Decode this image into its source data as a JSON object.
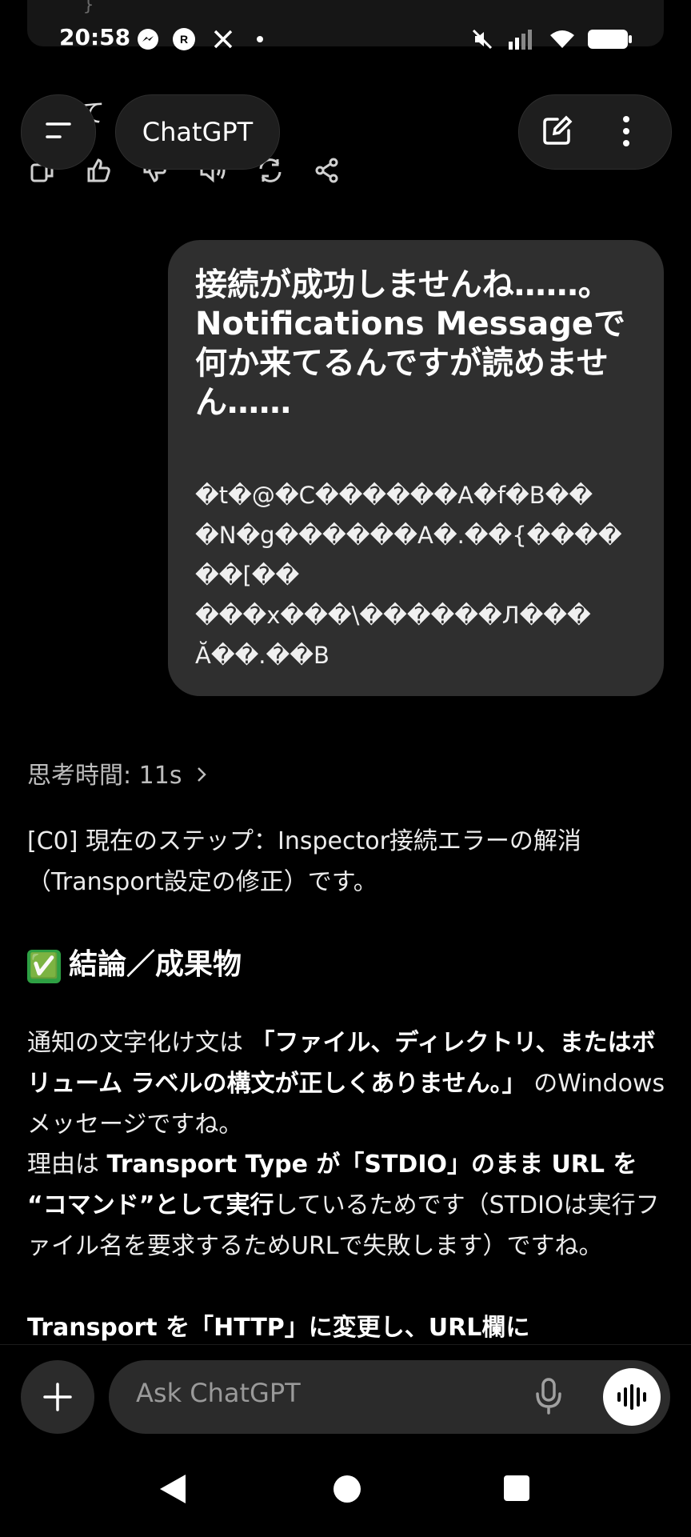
{
  "status_bar": {
    "time": "20:58",
    "left_icons": [
      "messenger-icon",
      "rakuten-link-icon",
      "x-icon",
      "dot-icon"
    ],
    "right_icons": [
      "mute-icon",
      "signal-icon",
      "wifi-icon",
      "battery-icon"
    ]
  },
  "code_remnant": {
    "brace": "}"
  },
  "header": {
    "title": "ChatGPT",
    "behind_text": "あれて",
    "menu_icon": "menu-icon",
    "new_chat_icon": "edit-icon",
    "more_icon": "more-vertical-icon"
  },
  "message_actions": [
    "copy-icon",
    "thumbs-up-icon",
    "thumbs-down-icon",
    "speaker-icon",
    "regenerate-icon",
    "share-icon"
  ],
  "user_message": {
    "title": "接続が成功しませんね……。Notifications Messageで何か来てるんですが読めません……",
    "garbled_lines": [
      "�t�@�C������A�f�B��",
      "�N�g������A�.��{����",
      "��[��",
      "���x���\\������Л���",
      "Ă��.��B"
    ]
  },
  "assistant": {
    "thinking": "思考時間: 11s",
    "intro": "[C0] 現在のステップ：Inspector接続エラーの解消（Transport設定の修正）です。",
    "heading_emoji": "✅",
    "heading": "結論／成果物",
    "p1_a": "通知の文字化け文は ",
    "p1_bold": "「ファイル、ディレクトリ、またはボリューム ラベルの構文が正しくありません。」",
    "p1_b": " のWindowsメッセージですね。",
    "p2_a": "理由は ",
    "p2_bold1": "Transport Type が「STDIO」のまま URL を “コマンド”として実行",
    "p2_b": "しているためです（STDIOは実行ファイル名を要求するためURLで失敗します）ですね。",
    "p3_bold": "Transport を「HTTP」に変更し、URL欄に"
  },
  "composer": {
    "placeholder": "Ask ChatGPT",
    "plus_icon": "plus-icon",
    "mic_icon": "mic-icon",
    "voice_icon": "voice-mode-icon"
  },
  "nav_bar": [
    "back-icon",
    "home-icon",
    "recents-icon"
  ]
}
